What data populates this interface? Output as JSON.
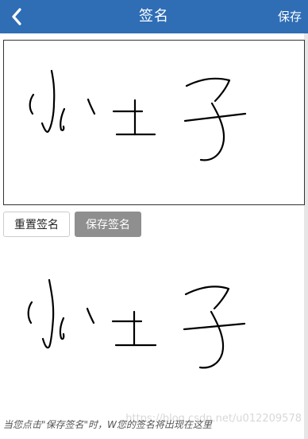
{
  "header": {
    "title": "签名",
    "save_label": "保存",
    "background": "#2f6db5"
  },
  "icons": {
    "back": "chevron-left-icon"
  },
  "buttons": {
    "reset_label": "重置签名",
    "save_label": "保存签名"
  },
  "signature": {
    "handwritten_text": "小王子"
  },
  "caption": "当您点击\"保存签名\"时，W您的签名将出现在这里",
  "watermark": "https://blog.csdn.net/u012209578"
}
